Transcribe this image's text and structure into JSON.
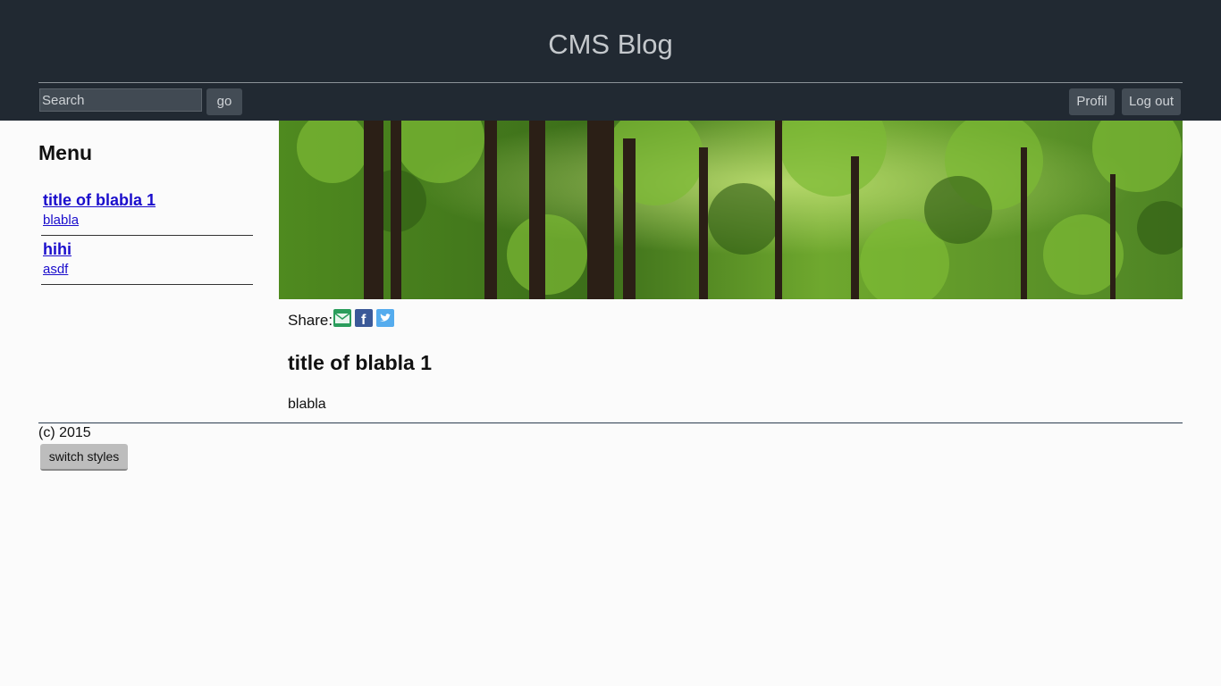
{
  "header": {
    "site_title": "CMS Blog",
    "search": {
      "placeholder": "Search",
      "value": ""
    },
    "go_label": "go",
    "profil_label": "Profil",
    "logout_label": "Log out"
  },
  "sidebar": {
    "heading": "Menu",
    "items": [
      {
        "title": "title of blabla 1",
        "subtitle": "blabla"
      },
      {
        "title": "hihi",
        "subtitle": "asdf"
      }
    ]
  },
  "post": {
    "share_label": "Share:",
    "share_icons": [
      "email-icon",
      "facebook-icon",
      "twitter-icon"
    ],
    "title": "title of blabla 1",
    "body": "blabla"
  },
  "footer": {
    "copyright": "(c) 2015",
    "switch_label": "switch styles"
  },
  "colors": {
    "header_bg": "#212932",
    "link": "#1a0dcc",
    "page_bg": "#fbfbfb"
  }
}
